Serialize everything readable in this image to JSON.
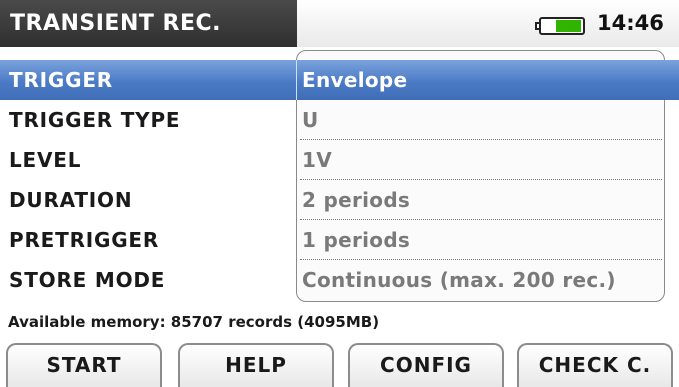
{
  "header": {
    "title": "TRANSIENT REC.",
    "time": "14:46",
    "battery_icon": "battery-icon",
    "battery_level": 0.65,
    "battery_color": "#30b400"
  },
  "settings": [
    {
      "label": "TRIGGER",
      "value": "Envelope",
      "selected": true
    },
    {
      "label": "TRIGGER TYPE",
      "value": "U",
      "selected": false
    },
    {
      "label": "LEVEL",
      "value": "1V",
      "selected": false
    },
    {
      "label": "DURATION",
      "value": "2 periods",
      "selected": false
    },
    {
      "label": "PRETRIGGER",
      "value": "1 periods",
      "selected": false
    },
    {
      "label": "STORE MODE",
      "value": "Continuous (max. 200 rec.)",
      "selected": false
    }
  ],
  "status": {
    "memory": "Available memory: 85707 records (4095MB)"
  },
  "function_keys": [
    {
      "label": "START"
    },
    {
      "label": "HELP"
    },
    {
      "label": "CONFIG"
    },
    {
      "label": "CHECK C."
    }
  ],
  "colors": {
    "selection": "#4c7bc6",
    "title_bar": "#333333"
  }
}
